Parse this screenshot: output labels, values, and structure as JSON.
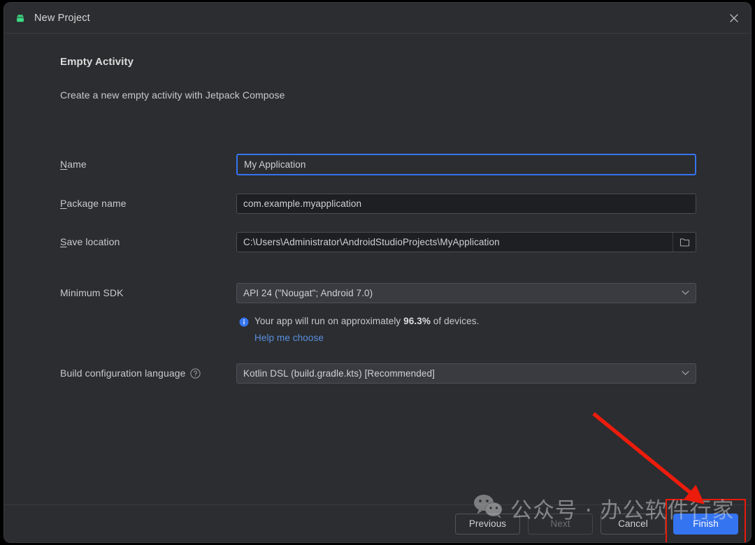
{
  "window": {
    "title": "New Project",
    "app_icon": "android-robot-icon",
    "close_icon": "close-icon"
  },
  "content": {
    "heading": "Empty Activity",
    "subheading": "Create a new empty activity with Jetpack Compose"
  },
  "fields": {
    "name": {
      "label_prefix": "",
      "label_mnemonic": "N",
      "label_rest": "ame",
      "value": "My Application",
      "focused": true
    },
    "package_name": {
      "label_mnemonic": "P",
      "label_rest": "ackage name",
      "value": "com.example.myapplication"
    },
    "save_location": {
      "label_mnemonic": "S",
      "label_rest": "ave location",
      "value": "C:\\Users\\Administrator\\AndroidStudioProjects\\MyApplication",
      "browse_icon": "folder-icon"
    },
    "minimum_sdk": {
      "label": "Minimum SDK",
      "value": "API 24 (\"Nougat\"; Android 7.0)",
      "dropdown_icon": "chevron-down-icon"
    },
    "build_config_language": {
      "label": "Build configuration language",
      "help_icon": "help-circle-icon",
      "value": "Kotlin DSL (build.gradle.kts) [Recommended]",
      "dropdown_icon": "chevron-down-icon"
    }
  },
  "info": {
    "icon": "info-icon",
    "text_before": "Your app will run on approximately",
    "percent": "96.3%",
    "text_after": "of devices.",
    "help_link": "Help me choose"
  },
  "footer": {
    "previous": "Previous",
    "next": "Next",
    "cancel": "Cancel",
    "finish": "Finish"
  },
  "annotation": {
    "highlight_color": "#e81a0c",
    "arrow": "red-arrow-pointing-to-finish"
  },
  "watermark": {
    "logo": "wechat-logo",
    "text": "公众号 · 办公软件行家"
  },
  "colors": {
    "accent": "#3574f0",
    "dialog_bg": "#2b2d30",
    "field_bg": "#1e1f22",
    "combo_bg": "#393b40",
    "link": "#5a90e0",
    "annotation_red": "#e81a0c",
    "android_green": "#3ddc84"
  }
}
